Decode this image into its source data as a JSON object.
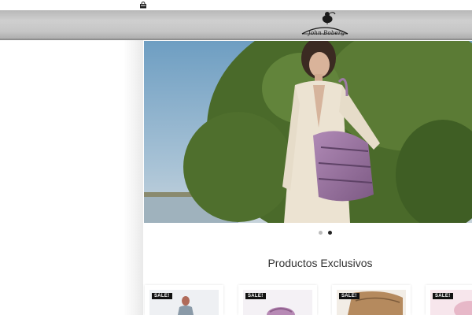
{
  "header": {
    "logo_text": "John Boberg",
    "cart_icon": "shopping-bag-icon"
  },
  "hero": {
    "slide_count": 2,
    "active_slide": 2
  },
  "main": {
    "section_title": "Productos Exclusivos"
  },
  "products": [
    {
      "badge": "SALE!"
    },
    {
      "badge": "SALE!"
    },
    {
      "badge": "SALE!"
    },
    {
      "badge": "SALE!"
    }
  ],
  "colors": {
    "header_gray": "#c6c6c6",
    "badge_bg": "#111111",
    "dot_active": "#222222",
    "dot_inactive": "#bcbcbc"
  }
}
